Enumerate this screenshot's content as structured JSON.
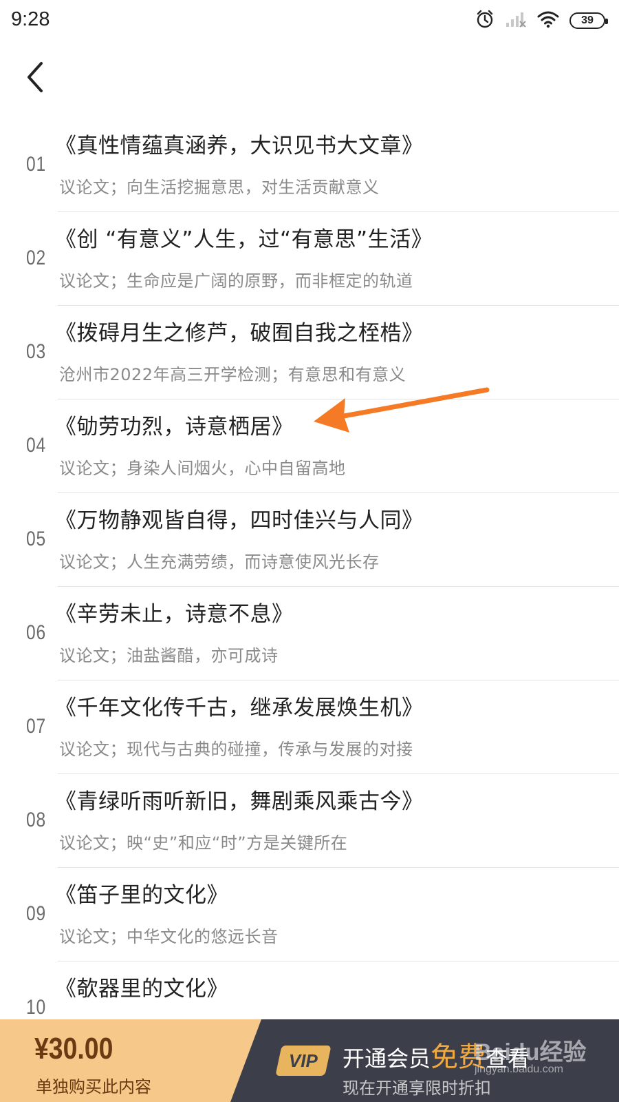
{
  "status": {
    "time": "9:28",
    "battery": "39",
    "icons": [
      "alarm-icon",
      "signal-icon",
      "wifi-icon",
      "battery-icon"
    ]
  },
  "nav": {
    "back_icon": "chevron-left-icon"
  },
  "chapters": [
    {
      "num": "01",
      "title": "《真性情蕴真涵养，大识见书大文章》",
      "subtitle": "议论文；向生活挖掘意思，对生活贡献意义"
    },
    {
      "num": "02",
      "title": "《创 “有意义”人生，过“有意思”生活》",
      "subtitle": "议论文；生命应是广阔的原野，而非框定的轨道"
    },
    {
      "num": "03",
      "title": "《拨碍月生之修芦，破囿自我之桎梏》",
      "subtitle": "沧州市2022年高三开学检测；有意思和有意义"
    },
    {
      "num": "04",
      "title": "《劬劳功烈，诗意栖居》",
      "subtitle": "议论文；身染人间烟火，心中自留高地"
    },
    {
      "num": "05",
      "title": "《万物静观皆自得，四时佳兴与人同》",
      "subtitle": "议论文；人生充满劳绩，而诗意使风光长存"
    },
    {
      "num": "06",
      "title": "《辛劳未止，诗意不息》",
      "subtitle": "议论文；油盐酱醋，亦可成诗"
    },
    {
      "num": "07",
      "title": "《千年文化传千古，继承发展焕生机》",
      "subtitle": "议论文；现代与古典的碰撞，传承与发展的对接"
    },
    {
      "num": "08",
      "title": "《青绿听雨听新旧，舞剧乘风乘古今》",
      "subtitle": "议论文；映“史”和应“时”方是关键所在"
    },
    {
      "num": "09",
      "title": "《笛子里的文化》",
      "subtitle": "议论文；中华文化的悠远长音"
    },
    {
      "num": "10",
      "title": "《欹器里的文化》",
      "subtitle": ""
    }
  ],
  "bottom": {
    "price": "¥30.00",
    "buy_label": "单独购买此内容",
    "vip_badge": "VIP",
    "vip_text_pre": "开通会员",
    "vip_text_highlight": "免费",
    "vip_text_post": "查看",
    "vip_subtext": "现在开通享限时折扣"
  },
  "watermark": {
    "logo": "Baidu经验",
    "url": "jingyan.baidu.com"
  },
  "colors": {
    "accent_orange": "#F47A25",
    "vip_dark": "#3C3F4A",
    "vip_gold": "#E8B45D",
    "buy_bg": "#F6C88A",
    "highlight": "#F0A940"
  }
}
